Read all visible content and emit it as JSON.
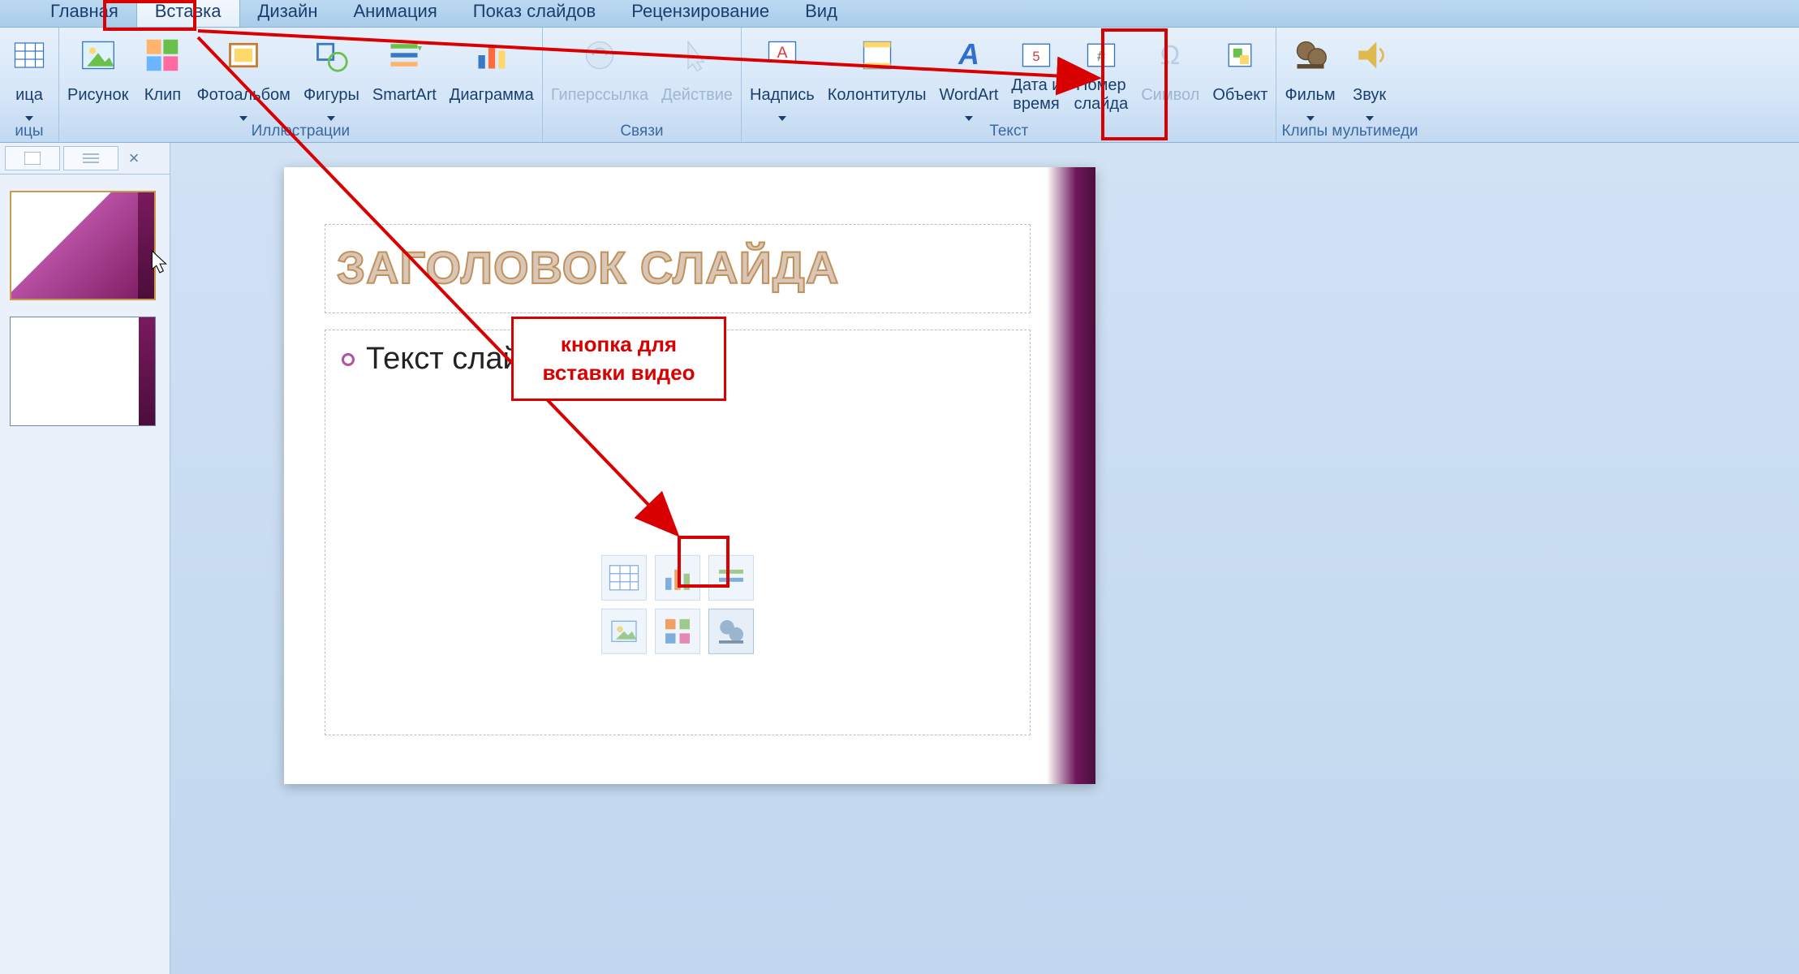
{
  "tabs": {
    "home": "Главная",
    "insert": "Вставка",
    "design": "Дизайн",
    "animation": "Анимация",
    "slideshow": "Показ слайдов",
    "review": "Рецензирование",
    "view": "Вид"
  },
  "ribbon": {
    "table_group": {
      "table": "ица",
      "label": "ицы"
    },
    "illustrations": {
      "picture": "Рисунок",
      "clip": "Клип",
      "photoalbum": "Фотоальбом",
      "shapes": "Фигуры",
      "smartart": "SmartArt",
      "chart": "Диаграмма",
      "label": "Иллюстрации"
    },
    "links": {
      "hyperlink": "Гиперссылка",
      "action": "Действие",
      "label": "Связи"
    },
    "text": {
      "textbox": "Надпись",
      "headerfooter": "Колонтитулы",
      "wordart": "WordArt",
      "datetime": "Дата и\nвремя",
      "slideno": "Номер\nслайда",
      "symbol": "Символ",
      "object": "Объект",
      "label": "Текст"
    },
    "media": {
      "movie": "Фильм",
      "sound": "Звук",
      "label": "Клипы мультимеди"
    }
  },
  "panel": {
    "close": "×"
  },
  "slide": {
    "title": "ЗАГОЛОВОК СЛАЙДА",
    "body": "Текст слай"
  },
  "annotation": {
    "line1": "кнопка для",
    "line2": "вставки видео"
  }
}
